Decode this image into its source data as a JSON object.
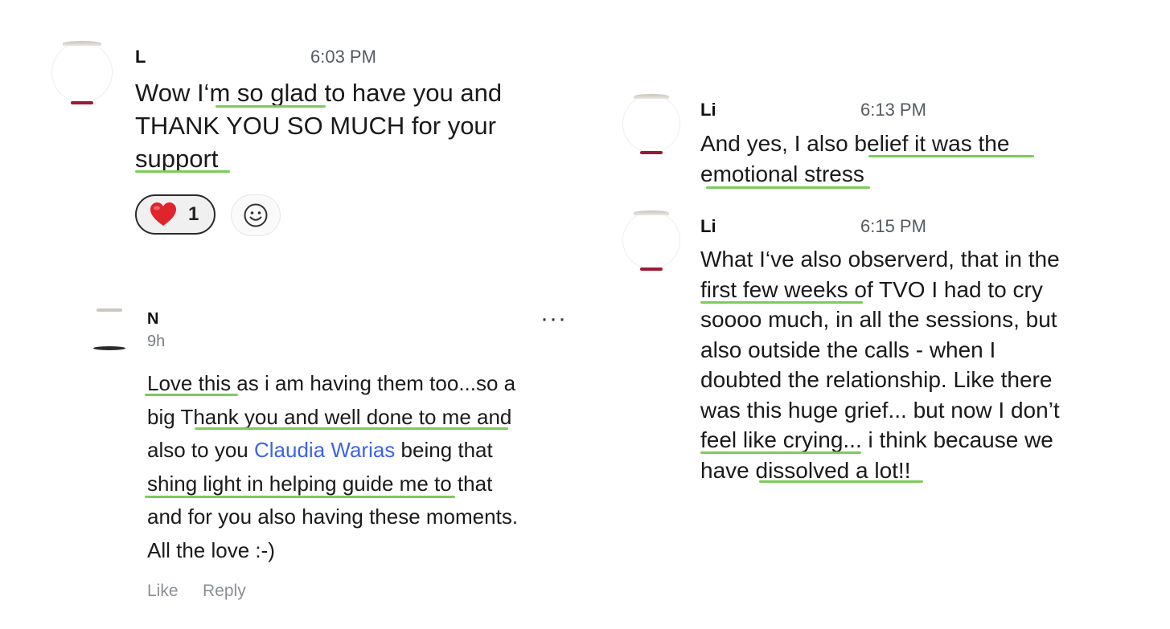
{
  "left_post": {
    "author": "L",
    "time": "6:03 PM",
    "lines": [
      "Wow I‘m so glad to have you and",
      "THANK YOU SO MUCH for your",
      "support"
    ],
    "reaction_emoji": "heart",
    "reaction_count": "1",
    "add_reaction_icon": "smiley-add-icon"
  },
  "comment": {
    "author": "N",
    "time": "9h",
    "more_label": "···",
    "line1": "Love this as i am having them too...so a",
    "line2": "big Thank you and well done to me and",
    "line3_before": "also to you ",
    "mention": "Claudia Warias",
    "line3_after": " being that",
    "line4": "shing light in helping guide me to that",
    "line5": "and for you also having these moments.",
    "line6": "All the love :-)",
    "like_label": "Like",
    "reply_label": "Reply"
  },
  "right_posts": [
    {
      "author": "Li",
      "time": "6:13 PM",
      "lines": [
        "And yes, I also belief it was the",
        "emotional stress"
      ]
    },
    {
      "author": "Li",
      "time": "6:15 PM",
      "lines": [
        "What I‘ve also observerd, that in the",
        "first few weeks of TVO I had to cry",
        "soooo much, in all the sessions, but",
        "also outside the calls - when I",
        "doubted the relationship. Like there",
        "was this huge grief... but now I don’t",
        "feel like crying... i think because we",
        "have dissolved a lot!!"
      ]
    }
  ],
  "highlight_color": "#7dcb5a",
  "mention_color": "#3d64e6"
}
